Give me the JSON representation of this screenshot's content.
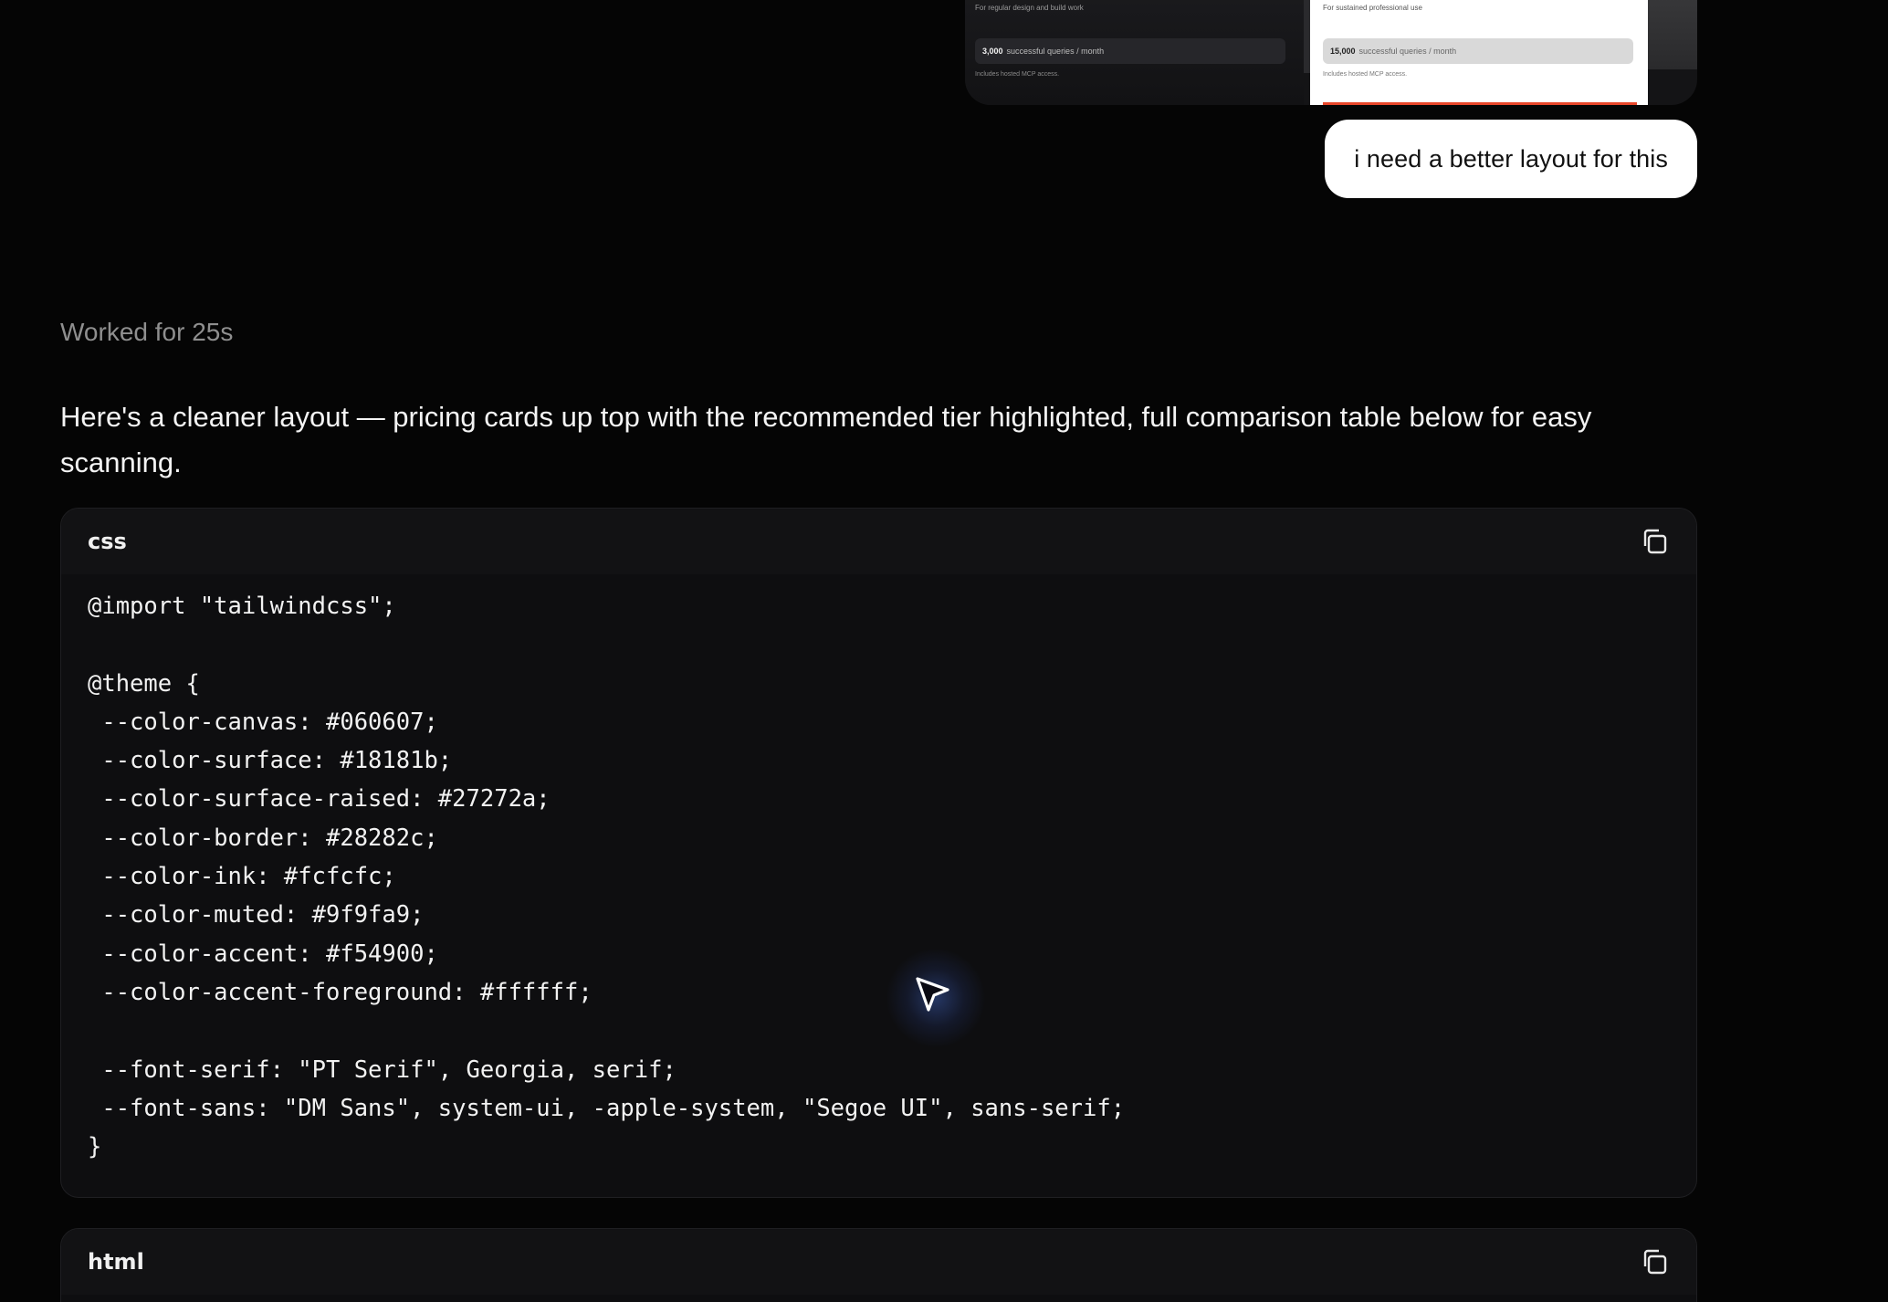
{
  "preview": {
    "left_card": {
      "subtitle": "For regular design and build work",
      "queries_value": "3,000",
      "queries_label": "successful queries / month",
      "note": "Includes hosted MCP access."
    },
    "right_card": {
      "subtitle": "For sustained professional use",
      "queries_value": "15,000",
      "queries_label": "successful queries / month",
      "note": "Includes hosted MCP access."
    },
    "accent_color": "#e8472a"
  },
  "user_message": "i need a better layout for this",
  "status": "Worked for 25s",
  "reply": "Here's a cleaner layout — pricing cards up top with the recommended tier highlighted, full comparison table below for easy scanning.",
  "code_blocks": [
    {
      "language": "css",
      "code": "@import \"tailwindcss\";\n\n@theme {\n --color-canvas: #060607;\n --color-surface: #18181b;\n --color-surface-raised: #27272a;\n --color-border: #28282c;\n --color-ink: #fcfcfc;\n --color-muted: #9f9fa9;\n --color-accent: #f54900;\n --color-accent-foreground: #ffffff;\n\n --font-serif: \"PT Serif\", Georgia, serif;\n --font-sans: \"DM Sans\", system-ui, -apple-system, \"Segoe UI\", sans-serif;\n}"
    },
    {
      "language": "html",
      "code": ""
    }
  ],
  "icons": {
    "copy": "copy-icon",
    "cursor": "mouse-pointer-icon"
  }
}
